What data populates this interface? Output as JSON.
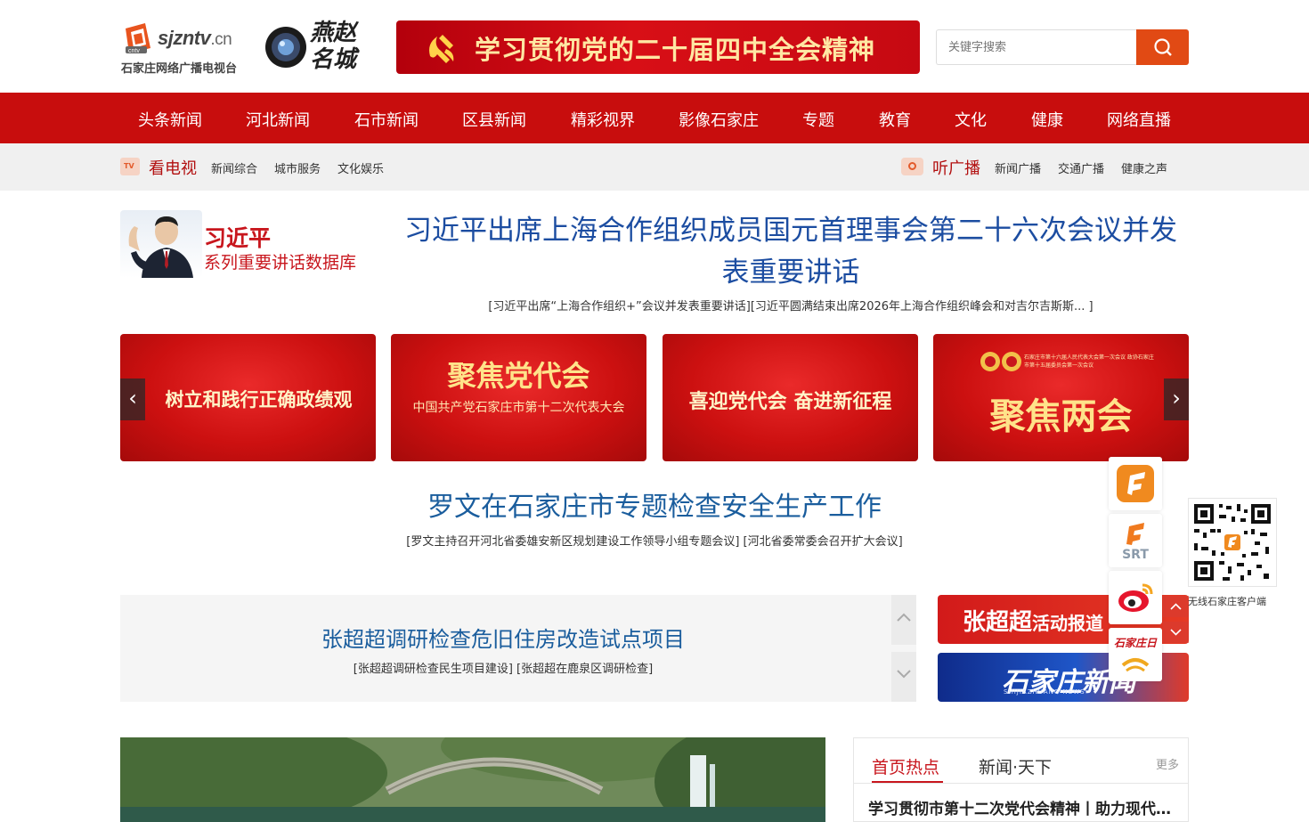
{
  "header": {
    "logo_domain": "sjzntv",
    "logo_tld": ".cn",
    "logo_subtitle": "石家庄网络广播电视台",
    "logo_badge": "cntv",
    "city_logo_text": "燕赵名城",
    "banner_text": "学习贯彻党的二十届四中全会精神",
    "search_placeholder": "关键字搜索"
  },
  "nav": {
    "items": [
      "头条新闻",
      "河北新闻",
      "石市新闻",
      "区县新闻",
      "精彩视界",
      "影像石家庄",
      "专题",
      "教育",
      "文化",
      "健康",
      "网络直播"
    ]
  },
  "subbar": {
    "tv_badge": "TV",
    "tv_title": "看电视",
    "tv_links": [
      "新闻综合",
      "城市服务",
      "文化娱乐"
    ],
    "radio_title": "听广播",
    "radio_links": [
      "新闻广播",
      "交通广播",
      "健康之声"
    ]
  },
  "feature": {
    "xi_name": "习近平",
    "xi_sub": "系列重要讲话数据库",
    "headline": "习近平出席上海合作组织成员国元首理事会第二十六次会议并发表重要讲话",
    "headline_sub": "[习近平出席“上海合作组织+”会议并发表重要讲话][习近平圆满结束出席2026年上海合作组织峰会和对吉尔吉斯斯... ]"
  },
  "carousel": {
    "slides": [
      {
        "title": "树立和践行正确政绩观",
        "small": ""
      },
      {
        "title": "聚焦党代会",
        "small": "中国共产党石家庄市第十二次代表大会"
      },
      {
        "title": "喜迎党代会  奋进新征程",
        "small": ""
      },
      {
        "title": "聚焦两会",
        "small": "石家庄市第十六届人民代表大会第一次会议 政协石家庄市第十五届委员会第一次会议"
      }
    ],
    "prev_label": "‹",
    "next_label": "›"
  },
  "second_news": {
    "headline": "罗文在石家庄市专题检查安全生产工作",
    "sub": "[罗文主持召开河北省委雄安新区规划建设工作领导小组专题会议] [河北省委常委会召开扩大会议]"
  },
  "scroll_news": {
    "headline": "张超超调研检查危旧住房改造试点项目",
    "sub": "[张超超调研检查民生项目建设] [张超超在鹿泉区调研检查]"
  },
  "promos": {
    "promo1_main": "张超超",
    "promo1_rest": "活动报道",
    "promo2_main": "石家庄新闻",
    "promo2_sub": "SHIJIAZHUANG NEWS"
  },
  "hot": {
    "tabs": [
      "首页热点",
      "新闻·天下"
    ],
    "more": "更多",
    "first_item": "学习贯彻市第十二次党代会精神丨助力现代化..."
  },
  "side": {
    "srt_label": "SRT",
    "app_label": "石家庄日",
    "qr_label": "无线石家庄客户端"
  },
  "colors": {
    "nav_red": "#c80d0d",
    "headline_blue": "#1c4da1",
    "search_orange": "#e14a14"
  }
}
